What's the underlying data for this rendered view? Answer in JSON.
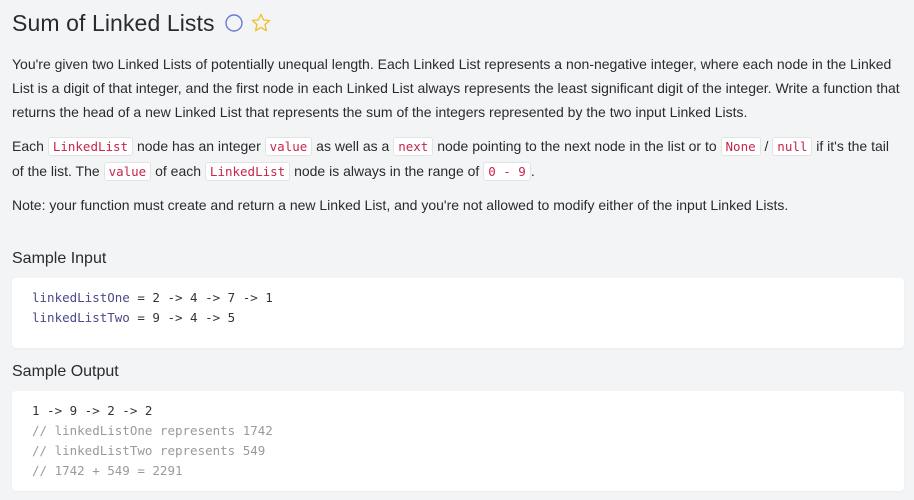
{
  "problem": {
    "title": "Sum of Linked Lists"
  },
  "description": {
    "p1": "You're given two Linked Lists of potentially unequal length. Each Linked List represents a non-negative integer, where each node in the Linked List is a digit of that integer, and the first node in each Linked List always represents the least significant digit of the integer. Write a function that returns the head of a new Linked List that represents the sum of the integers represented by the two input Linked Lists.",
    "p2": {
      "t1": "Each ",
      "c1": "LinkedList",
      "t2": " node has an integer ",
      "c2": "value",
      "t3": " as well as a ",
      "c3": "next",
      "t4": " node pointing to the next node in the list or to ",
      "c4": "None",
      "t5": " / ",
      "c5": "null",
      "t6": " if it's the tail of the list. The ",
      "c6": "value",
      "t7": " of each ",
      "c7": "LinkedList",
      "t8": " node is always in the range of ",
      "c8": "0 - 9",
      "t9": "."
    },
    "p3": "Note: your function must create and return a new Linked List, and you're not allowed to modify either of the input Linked Lists."
  },
  "sample_input": {
    "heading": "Sample Input",
    "line1_var": "linkedListOne",
    "line1_rest": " = 2 -> 4 -> 7 -> 1",
    "line2_var": "linkedListTwo",
    "line2_rest": " = 9 -> 4 -> 5"
  },
  "sample_output": {
    "heading": "Sample Output",
    "line1": "1 -> 9 -> 2 -> 2",
    "comment1": "// linkedListOne represents 1742",
    "comment2": "// linkedListTwo represents 549",
    "comment3": "// 1742 + 549 = 2291"
  },
  "colors": {
    "code_text": "#c7254e",
    "star": "#f2c12e",
    "status_circle": "#6b7bd6"
  }
}
